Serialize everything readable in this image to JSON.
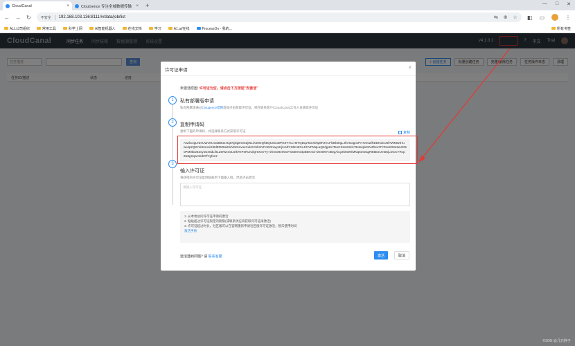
{
  "browser": {
    "tabs": [
      {
        "label": "CloudCanal"
      },
      {
        "label": "ClouGence 专注全域数据传输"
      }
    ],
    "new_tab": "+",
    "address": {
      "security": "不安全",
      "url": "192.168.103.136:8111/#/data/job/list"
    },
    "bookmarks": [
      "ALL公司组织",
      "常用工具",
      "科学上网",
      "AI智能机器人",
      "在线文档",
      "学习",
      "A1.ai/在线",
      "ProcessOn - 我的..."
    ],
    "bookmarks_right": "所有书签"
  },
  "app": {
    "logo": "CloudCanal",
    "nav": [
      "同步任务",
      "同步链路",
      "数据源管理",
      "系统设置"
    ],
    "version": "v4.1.0.1",
    "lang": "中文",
    "user": "Trial"
  },
  "filters": {
    "select_placeholder": "任务描述",
    "query_button": "查询",
    "right_buttons": [
      "+ 创建任务",
      "批量创建任务",
      "克隆/删除任务",
      "任务操作日志",
      "清理"
    ]
  },
  "table": {
    "headers": [
      "任务ID/描述",
      "状态",
      "进度"
    ]
  },
  "dialog": {
    "title": "许可证申请",
    "close": "×",
    "reason_label": "未激活原因:",
    "reason_text": "许可证为空，请点击下方按钮\"去激活\"",
    "steps": [
      {
        "num": "1",
        "title": "私有部署版申请",
        "desc_pre": "私有部署请通过",
        "desc_link": "Clougence官网",
        "desc_post": "直接点击获取许可证，或在联系客户/CloudCanal工作人员获取许可证"
      },
      {
        "num": "2",
        "title": "复制申请码",
        "desc": "复制下面的申请码，并选择联系方式获取许可证"
      },
      {
        "num": "3",
        "title": "输入许可证",
        "desc": "将获得的许可证复制粘贴到下面输入框，然后点击激活"
      }
    ],
    "copy_label": "复制",
    "apply_code": "AwdCogLNmUWUHJowB8U1HqeNjSgEGGZjr5LiXJ0GQh5QU5nuDPG0T7cLH0TQDqzTanXiNp8FZVLFlvBb0IgLJhVOagovPA7e0cZ/hDDNdcU5fAWN8ziHuwUqIzQ8YdcKonoiXl0dERZ6eZwlVMGnvoxCukXCkkIzVPcDOnwyeKjHJ4lYGNHZCcJ/CVFMqLaQ2/gpHnTaeCSzoX34lv7BJwqkcMVZlUw7FrRJwtO8L9w4O5vPM0tlx262vyD1e0dLl/tLZOWcSvL5Ik7KP4RLKdQr0XaY7y+zhmO8e0OcFS33NrO3p5BKmd+25NWYc8DgAiuyZk5W0iMNq5eIDagRB5E2Um55jLDCCYRcpZa8gSqwAEd07fYgfonz",
    "license_placeholder": "请输入许可证",
    "notes": [
      "1. 从本地访问许可证申请码激活",
      "2. 粘贴超过许可证限定的期限(或联系供应商获取许可证再激活)",
      "3. 许可证超过时长，社区版可以在官网重新申请社区版许可证激活，暂未使用时间"
    ],
    "notes_link": "激活手册",
    "footer_pre": "激活遇到问题? 请",
    "footer_link": "联系客服",
    "ok": "激活",
    "cancel": "取消"
  },
  "watermark": "©SDN @几只胖子"
}
